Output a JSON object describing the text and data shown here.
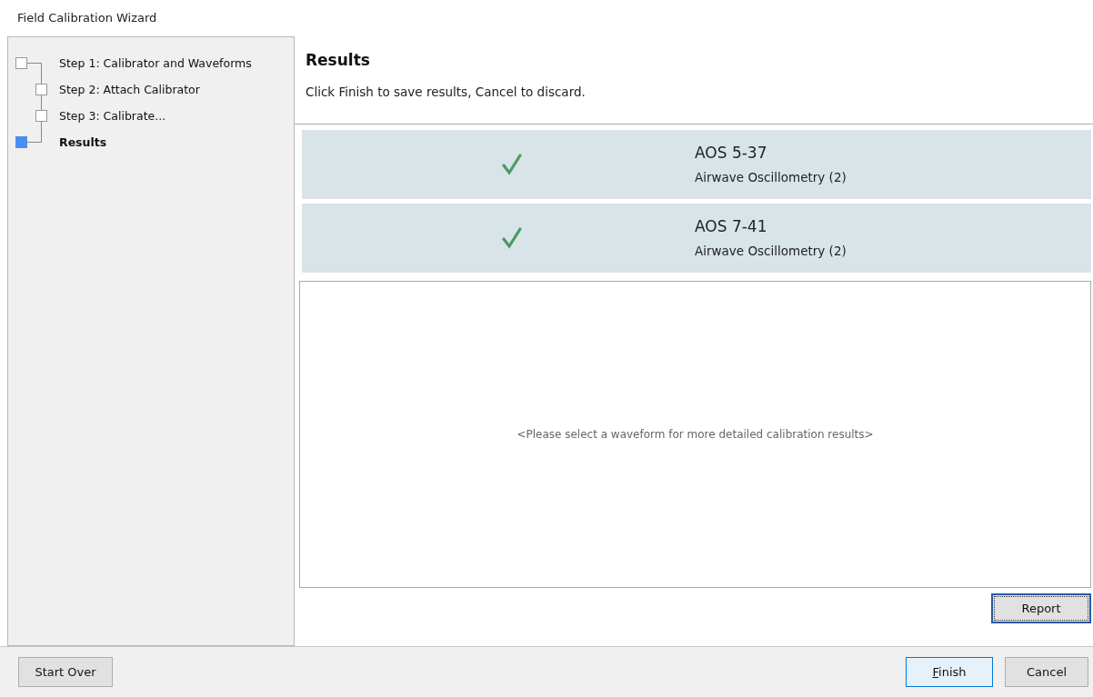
{
  "window": {
    "title": "Field Calibration Wizard"
  },
  "steps": [
    {
      "label": "Step 1: Calibrator and Waveforms",
      "selected": false,
      "children": [
        {
          "label": "Step 2: Attach Calibrator",
          "selected": false
        },
        {
          "label": "Step 3: Calibrate...",
          "selected": false
        }
      ]
    },
    {
      "label": "Results",
      "selected": true
    }
  ],
  "page": {
    "heading": "Results",
    "instruction": "Click Finish to save results, Cancel to discard."
  },
  "results": [
    {
      "name": "AOS 5-37",
      "detail": "Airwave Oscillometry (2)",
      "passed": true,
      "selected": false
    },
    {
      "name": "AOS 7-41",
      "detail": "Airwave Oscillometry (2)",
      "passed": true,
      "selected": false
    }
  ],
  "detail_placeholder": "<Please select a waveform for more detailed calibration results>",
  "report_button": "Report",
  "buttons": {
    "start_over": "Start Over",
    "finish": "Finish",
    "cancel": "Cancel"
  }
}
